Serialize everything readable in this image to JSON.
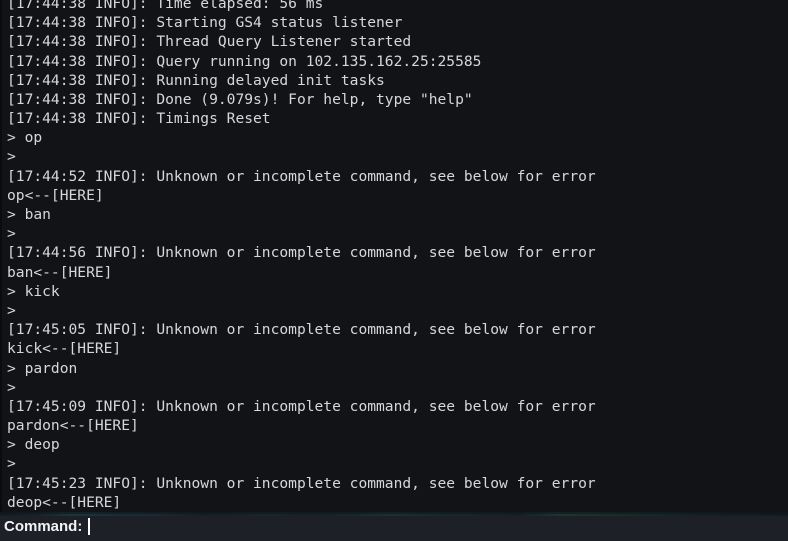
{
  "window": {
    "type": "minecraft-server-console",
    "background_color": "#121317",
    "text_color": "#d6d7db",
    "bar_color": "#1d2127"
  },
  "console": {
    "lines": [
      "[17:44:38 INFO]: Time elapsed: 56 ms",
      "[17:44:38 INFO]: Starting GS4 status listener",
      "[17:44:38 INFO]: Thread Query Listener started",
      "[17:44:38 INFO]: Query running on 102.135.162.25:25585",
      "[17:44:38 INFO]: Running delayed init tasks",
      "[17:44:38 INFO]: Done (9.079s)! For help, type \"help\"",
      "[17:44:38 INFO]: Timings Reset",
      "> op",
      ">",
      "[17:44:52 INFO]: Unknown or incomplete command, see below for error",
      "op<--[HERE]",
      "> ban",
      ">",
      "[17:44:56 INFO]: Unknown or incomplete command, see below for error",
      "ban<--[HERE]",
      "> kick",
      ">",
      "[17:45:05 INFO]: Unknown or incomplete command, see below for error",
      "kick<--[HERE]",
      "> pardon",
      ">",
      "[17:45:09 INFO]: Unknown or incomplete command, see below for error",
      "pardon<--[HERE]",
      "> deop",
      ">",
      "[17:45:23 INFO]: Unknown or incomplete command, see below for error",
      "deop<--[HERE]"
    ]
  },
  "command_bar": {
    "label": "Command:",
    "value": "",
    "placeholder": ""
  }
}
